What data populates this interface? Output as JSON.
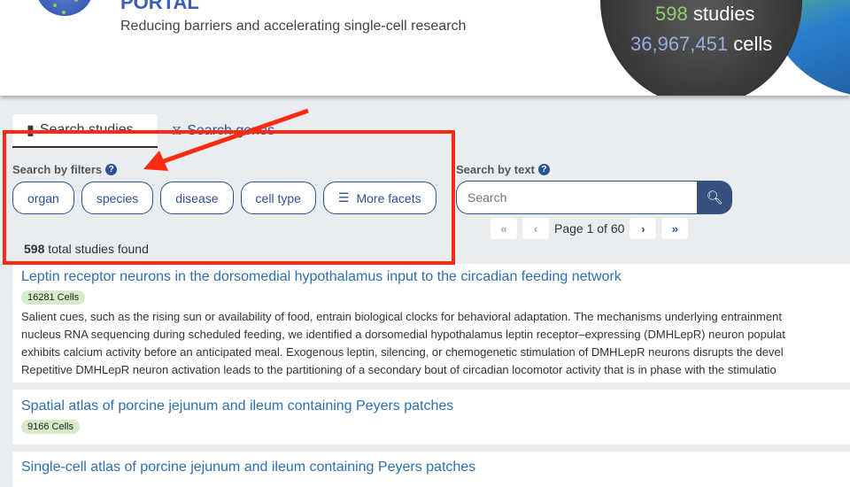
{
  "header": {
    "title": "PORTAL",
    "tagline": "Reducing barriers and accelerating single-cell research",
    "stats": {
      "studies_count": "598",
      "studies_label": "studies",
      "cells_count": "36,967,451",
      "cells_label": "cells"
    }
  },
  "tabs": [
    {
      "label": "Search studies",
      "icon": "book-icon",
      "active": true
    },
    {
      "label": "Search genes",
      "icon": "dna-icon",
      "active": false
    }
  ],
  "filters": {
    "label": "Search by filters",
    "items": [
      "organ",
      "species",
      "disease",
      "cell type"
    ],
    "more": "More facets"
  },
  "text_search": {
    "label": "Search by text",
    "placeholder": "Search"
  },
  "results": {
    "count": "598",
    "count_suffix": "total studies found"
  },
  "pager": {
    "text": "Page 1 of 60"
  },
  "studies": [
    {
      "title": "Leptin receptor neurons in the dorsomedial hypothalamus input to the circadian feeding network",
      "cells": "16281 Cells",
      "description": [
        "Salient cues, such as the rising sun or availability of food, entrain biological clocks for behavioral adaptation. The mechanisms underlying entrainment",
        "nucleus RNA sequencing during scheduled feeding, we identified a dorsomedial hypothalamus leptin receptor–expressing (DMHLepR) neuron populat",
        "exhibits calcium activity before an anticipated meal. Exogenous leptin, silencing, or chemogenetic stimulation of DMHLepR neurons disrupts the devel",
        "Repetitive DMHLepR neuron activation leads to the partitioning of a secondary bout of circadian locomotor activity that is in phase with the stimulatio"
      ]
    },
    {
      "title": "Spatial atlas of porcine jejunum and ileum containing Peyers patches",
      "cells": "9166 Cells"
    },
    {
      "title": "Single-cell atlas of porcine jejunum and ileum containing Peyers patches"
    }
  ],
  "colors": {
    "brand": "#2d5095",
    "annotation": "#ff2a12",
    "badge": "#d8ebc8"
  }
}
